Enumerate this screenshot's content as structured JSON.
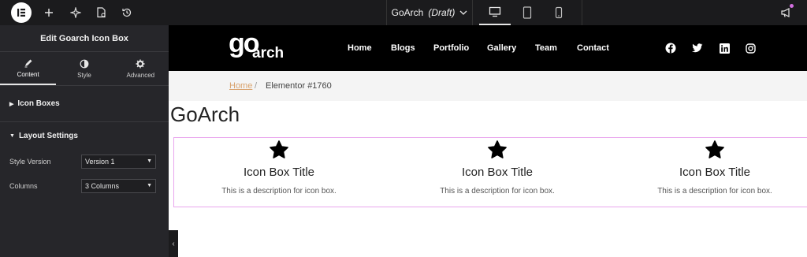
{
  "topbar": {
    "doc_name": "GoArch",
    "doc_status": "(Draft)"
  },
  "panel": {
    "title": "Edit Goarch Icon Box",
    "tabs": [
      {
        "label": "Content",
        "icon": "pencil-icon"
      },
      {
        "label": "Style",
        "icon": "half-circle-icon"
      },
      {
        "label": "Advanced",
        "icon": "gear-icon"
      }
    ],
    "sections": {
      "icon_boxes": "Icon Boxes",
      "layout_settings": "Layout Settings"
    },
    "fields": [
      {
        "label": "Style Version",
        "value": "Version 1"
      },
      {
        "label": "Columns",
        "value": "3 Columns"
      }
    ]
  },
  "site": {
    "logo_top": "go",
    "logo_bottom": "arch",
    "nav": [
      "Home",
      "Blogs",
      "Portfolio",
      "Gallery",
      "Team",
      "Contact"
    ],
    "social": [
      "facebook-icon",
      "twitter-icon",
      "linkedin-icon",
      "instagram-icon"
    ]
  },
  "breadcrumb": {
    "home": "Home",
    "separator": "/",
    "current": "Elementor #1760"
  },
  "page_title": "GoArch",
  "icon_boxes": [
    {
      "title": "Icon Box Title",
      "description": "This is a description for icon box."
    },
    {
      "title": "Icon Box Title",
      "description": "This is a description for icon box."
    },
    {
      "title": "Icon Box Title",
      "description": "This is a description for icon box."
    }
  ],
  "colors": {
    "topbar_bg": "#1b1b1d",
    "panel_bg": "#26262a",
    "breadcrumb_link": "#d9a36e",
    "selection_border": "#e9a6ee",
    "notification_dot": "#d36fe0"
  }
}
